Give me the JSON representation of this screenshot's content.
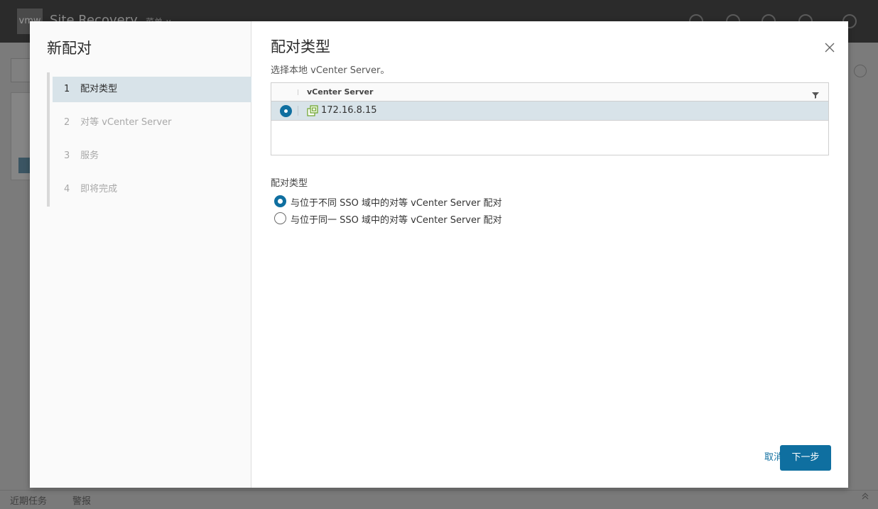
{
  "background": {
    "app_logo": "vmw",
    "app_title": "Site Recovery",
    "app_menu": "菜单 ∨",
    "bottom_tabs": [
      "近期任务",
      "警报"
    ]
  },
  "wizard": {
    "title": "新配对",
    "steps": [
      {
        "num": "1",
        "label": "配对类型",
        "active": true
      },
      {
        "num": "2",
        "label": "对等 vCenter Server",
        "active": false
      },
      {
        "num": "3",
        "label": "服务",
        "active": false
      },
      {
        "num": "4",
        "label": "即将完成",
        "active": false
      }
    ]
  },
  "page": {
    "title": "配对类型",
    "instruction": "选择本地 vCenter Server。",
    "grid": {
      "column": "vCenter Server",
      "rows": [
        {
          "value": "172.16.8.15",
          "selected": true
        }
      ]
    },
    "pairing_type_label": "配对类型",
    "options": [
      {
        "label": "与位于不同 SSO 域中的对等 vCenter Server 配对",
        "checked": true
      },
      {
        "label": "与位于同一 SSO 域中的对等 vCenter Server 配对",
        "checked": false
      }
    ]
  },
  "footer": {
    "cancel_label": "取消",
    "next_label": "下一步"
  },
  "colors": {
    "accent": "#0f6fa0",
    "selected_row": "#d8e3e9"
  },
  "icons": [
    "close-icon",
    "filter-icon",
    "vcenter-server-icon",
    "chevron-up-icon"
  ]
}
